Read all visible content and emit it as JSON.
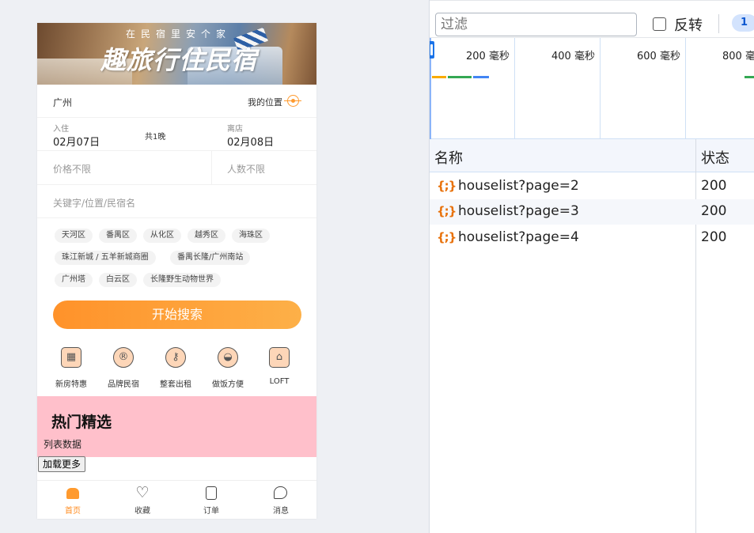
{
  "app": {
    "banner": {
      "subtitle": "在民宿里安个家",
      "title": "趣旅行住民宿"
    },
    "city": {
      "name": "广州",
      "my_location": "我的位置"
    },
    "dates": {
      "checkin_label": "入住",
      "checkin": "02月07日",
      "nights": "共1晚",
      "checkout_label": "离店",
      "checkout": "02月08日"
    },
    "filters": {
      "price": "价格不限",
      "people": "人数不限"
    },
    "keyword_placeholder": "关键字/位置/民宿名",
    "tags": [
      "天河区",
      "番禺区",
      "从化区",
      "越秀区",
      "海珠区",
      "珠江新城 / 五羊新城商圈",
      "番禺长隆/广州南站",
      "广州塔",
      "白云区",
      "长隆野生动物世界"
    ],
    "search_button": "开始搜索",
    "categories": [
      {
        "label": "新房特惠",
        "icon": "new-house-icon"
      },
      {
        "label": "品牌民宿",
        "icon": "brand-icon"
      },
      {
        "label": "整套出租",
        "icon": "key-icon"
      },
      {
        "label": "做饭方便",
        "icon": "cooking-pot-icon"
      },
      {
        "label": "LOFT",
        "icon": "loft-icon"
      }
    ],
    "hot": {
      "title": "热门精选",
      "desc": "列表数据"
    },
    "load_more": "加载更多",
    "tabs": [
      {
        "label": "首页",
        "icon": "home-icon",
        "active": true
      },
      {
        "label": "收藏",
        "icon": "heart-icon",
        "active": false
      },
      {
        "label": "订单",
        "icon": "order-icon",
        "active": false
      },
      {
        "label": "消息",
        "icon": "message-icon",
        "active": false
      }
    ],
    "accent_color": "#ff922a"
  },
  "devtools": {
    "filter_placeholder": "过滤",
    "invert_label": "反转",
    "badge": "1",
    "timeline_labels": [
      "200 毫秒",
      "400 毫秒",
      "600 毫秒",
      "800 毫秒"
    ],
    "columns": {
      "name": "名称",
      "status": "状态"
    },
    "requests": [
      {
        "name": "houselist?page=2",
        "status": "200",
        "type_icon": "xhr-icon"
      },
      {
        "name": "houselist?page=3",
        "status": "200",
        "type_icon": "xhr-icon"
      },
      {
        "name": "houselist?page=4",
        "status": "200",
        "type_icon": "xhr-icon"
      }
    ],
    "xhr_glyph": "{;}"
  }
}
